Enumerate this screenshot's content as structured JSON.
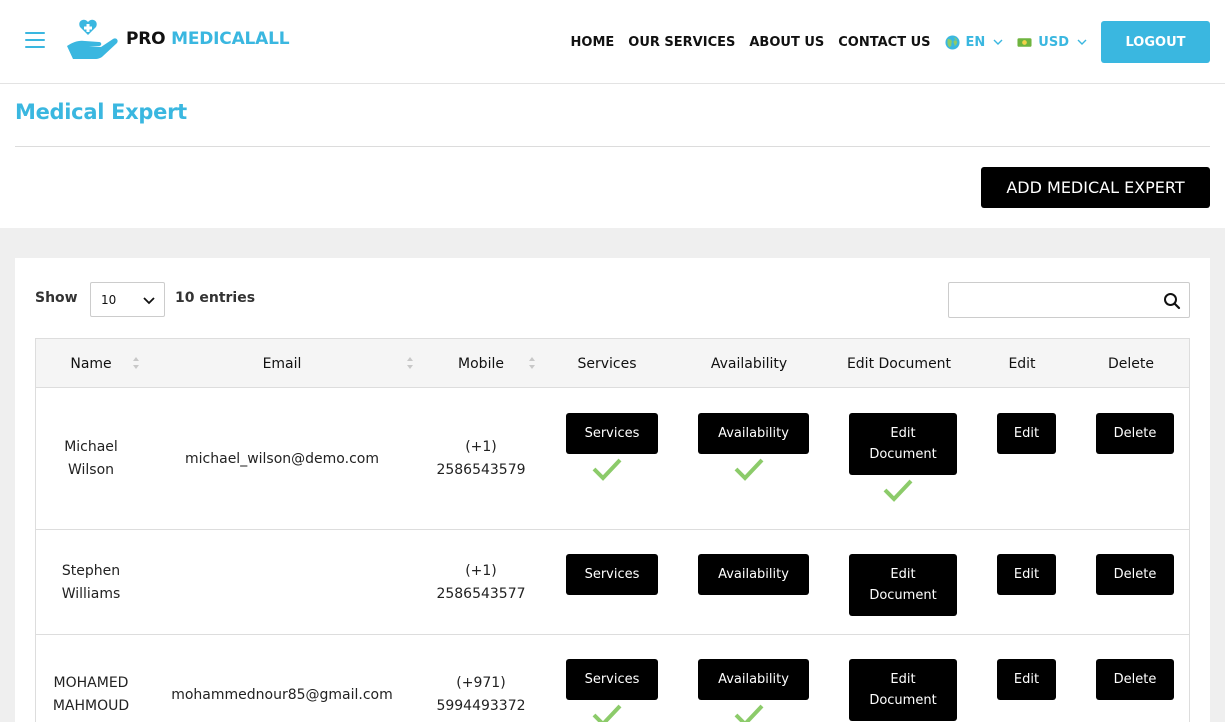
{
  "header": {
    "logo_pro": "PRO",
    "logo_medical": "MEDICALALL",
    "nav": [
      "HOME",
      "OUR SERVICES",
      "ABOUT US",
      "CONTACT US"
    ],
    "language": "EN",
    "currency": "USD",
    "logout_label": "LOGOUT",
    "accent_color": "#3ab7e0"
  },
  "page": {
    "title": "Medical Expert",
    "add_button_label": "ADD MEDICAL EXPERT"
  },
  "table_controls": {
    "show_label": "Show",
    "entries_value": "10",
    "entries_label": "10 entries",
    "search_value": ""
  },
  "table": {
    "columns": [
      "Name",
      "Email",
      "Mobile",
      "Services",
      "Availability",
      "Edit Document",
      "Edit",
      "Delete"
    ],
    "button_labels": {
      "services": "Services",
      "availability": "Availability",
      "edit_document_line1": "Edit",
      "edit_document_line2": "Document",
      "edit": "Edit",
      "delete": "Delete"
    },
    "rows": [
      {
        "name_line1": "Michael",
        "name_line2": "Wilson",
        "email": "michael_wilson@demo.com",
        "code": "(+1)",
        "number": "2586543579",
        "services_done": true,
        "availability_done": true,
        "document_done": true
      },
      {
        "name_line1": "Stephen",
        "name_line2": "Williams",
        "email": "",
        "code": "(+1)",
        "number": "2586543577",
        "services_done": false,
        "availability_done": false,
        "document_done": false
      },
      {
        "name_line1": "MOHAMED",
        "name_line2": "MAHMOUD",
        "email": "mohammednour85@gmail.com",
        "code": "(+971)",
        "number": "5994493372",
        "services_done": true,
        "availability_done": true,
        "document_done": false
      }
    ]
  },
  "colors": {
    "check_green": "#8ccb6a",
    "button_black": "#000000",
    "gray_band": "#efefef"
  }
}
